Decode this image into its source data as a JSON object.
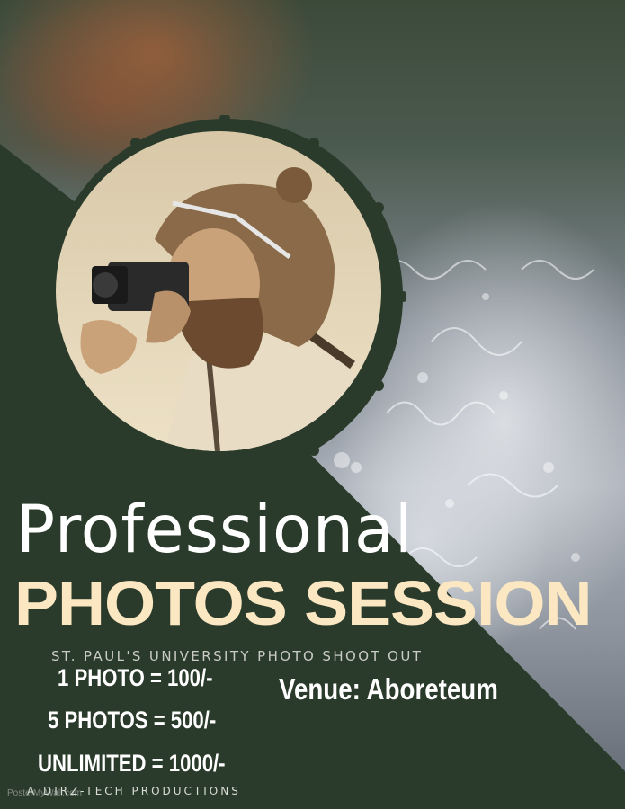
{
  "poster": {
    "title_line1": "Professional",
    "title_line2": "PHOTOS SESSION",
    "subtitle": "ST. PAUL'S UNIVERSITY PHOTO SHOOT OUT",
    "prices": [
      "1 PHOTO = 100/-",
      "5 PHOTOS = 500/-",
      "UNLIMITED = 1000/-"
    ],
    "venue": "Venue: Aboreteum",
    "footer": "A DIRZ-TECH PRODUCTIONS",
    "watermark": "PosterMyWall.com"
  },
  "colors": {
    "dark_green": "#2b3b2b",
    "cream": "#fbe7c2",
    "white": "#ffffff"
  }
}
